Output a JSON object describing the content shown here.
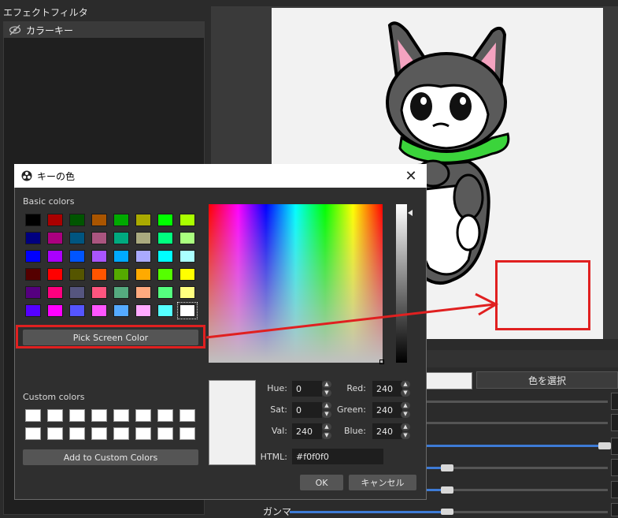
{
  "filter_panel": {
    "title": "エフェクトフィルタ",
    "filters": [
      {
        "label": "カラーキー",
        "icon": "eye-slash-icon"
      }
    ]
  },
  "properties": {
    "select_color_label": "色を選択",
    "gamma_label": "ガンマ"
  },
  "dialog": {
    "title": "キーの色",
    "title_icon": "obs-logo-icon",
    "close_label": "✕",
    "basic_colors_label": "Basic colors",
    "basic_colors": [
      "#000000",
      "#aa0000",
      "#005500",
      "#aa5500",
      "#00aa00",
      "#aaaa00",
      "#00ff00",
      "#aaff00",
      "#000080",
      "#aa007f",
      "#005580",
      "#aa557f",
      "#00aa7f",
      "#aaaa7f",
      "#00ff7f",
      "#aaff7f",
      "#0000ff",
      "#aa00ff",
      "#0055ff",
      "#aa55ff",
      "#00aaff",
      "#aaaaff",
      "#00ffff",
      "#aaffff",
      "#550000",
      "#ff0000",
      "#555500",
      "#ff5500",
      "#55aa00",
      "#ffaa00",
      "#55ff00",
      "#ffff00",
      "#55007f",
      "#ff007f",
      "#55557f",
      "#ff557f",
      "#55aa7f",
      "#ffaa7f",
      "#55ff7f",
      "#ffff7f",
      "#5500ff",
      "#ff00ff",
      "#5555ff",
      "#ff55ff",
      "#55aaff",
      "#ffaaff",
      "#55ffff",
      "#ffffff"
    ],
    "pick_screen_color_label": "Pick Screen Color",
    "custom_colors_label": "Custom colors",
    "custom_colors": [
      "#ffffff",
      "#ffffff",
      "#ffffff",
      "#ffffff",
      "#ffffff",
      "#ffffff",
      "#ffffff",
      "#ffffff",
      "#ffffff",
      "#ffffff",
      "#ffffff",
      "#ffffff",
      "#ffffff",
      "#ffffff",
      "#ffffff",
      "#ffffff"
    ],
    "add_custom_label": "Add to Custom Colors",
    "hue_label": "Hue:",
    "hue_value": "0",
    "sat_label": "Sat:",
    "sat_value": "0",
    "val_label": "Val:",
    "val_value": "240",
    "red_label": "Red:",
    "red_value": "240",
    "green_label": "Green:",
    "green_value": "240",
    "blue_label": "Blue:",
    "blue_value": "240",
    "html_label": "HTML:",
    "html_value": "#f0f0f0",
    "current_color": "#f0f0f0",
    "ok_label": "OK",
    "cancel_label": "キャンセル"
  },
  "annotation_color": "#e02020"
}
